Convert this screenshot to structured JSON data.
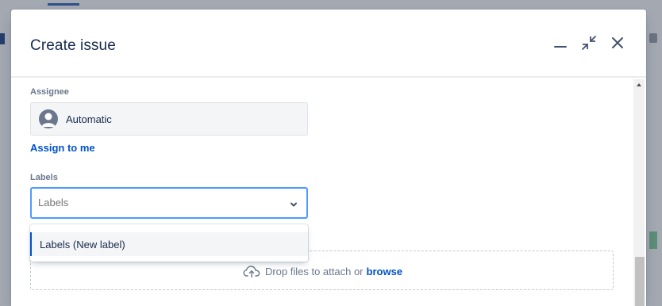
{
  "modal": {
    "title": "Create issue"
  },
  "header_buttons": {
    "minimize_icon": "minimize-icon",
    "collapse_icon": "collapse-arrows-icon",
    "close_icon": "close-icon"
  },
  "assignee": {
    "label": "Assignee",
    "value": "Automatic",
    "avatar_icon": "default-user-avatar",
    "assign_to_me": "Assign to me"
  },
  "labels": {
    "label": "Labels",
    "placeholder": "Labels",
    "chevron_icon": "chevron-down-icon",
    "options": [
      "Labels (New label)"
    ]
  },
  "attachment": {
    "icon": "cloud-upload-icon",
    "text": "Drop files to attach or",
    "browse": "browse"
  },
  "colors": {
    "accent": "#0052cc",
    "focus_border": "#4c9aff",
    "text": "#172b4d",
    "muted": "#6b778c"
  }
}
